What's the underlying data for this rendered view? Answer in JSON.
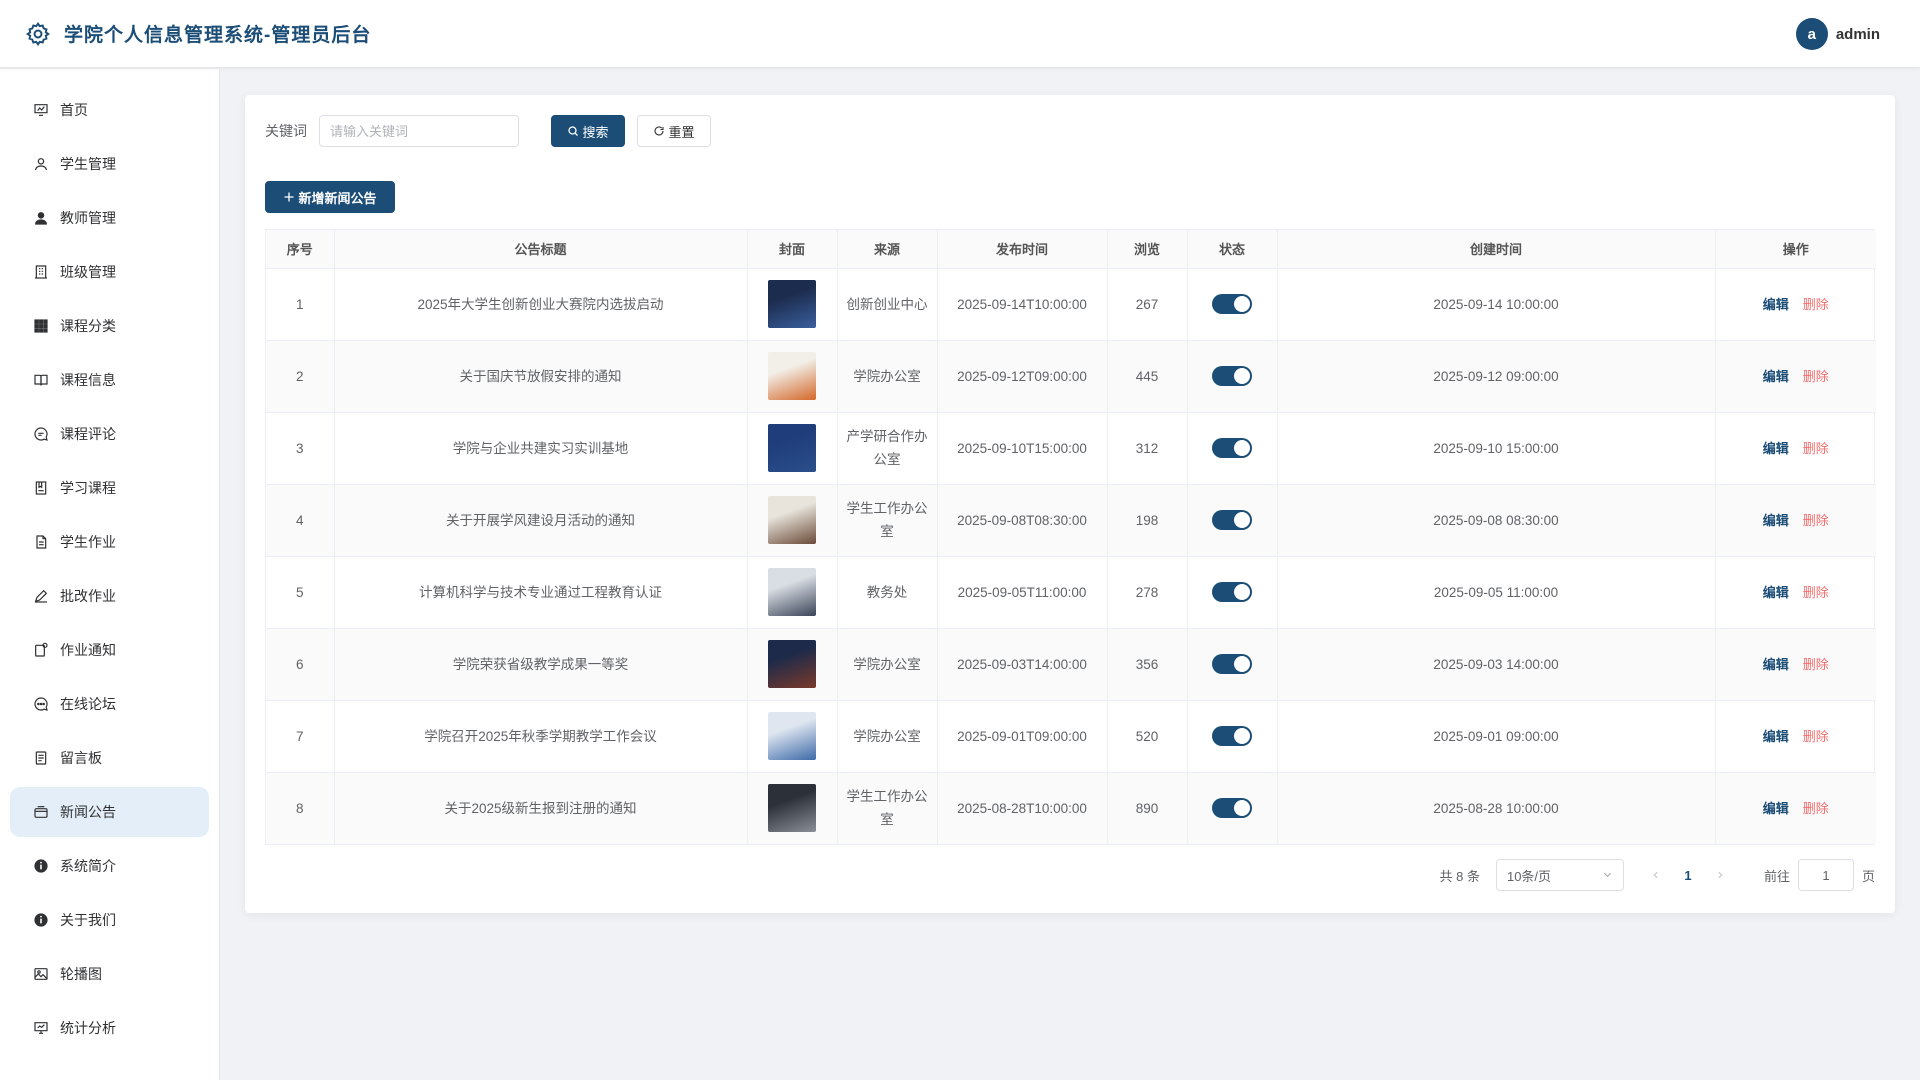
{
  "header": {
    "title": "学院个人信息管理系统-管理员后台",
    "avatar_letter": "a",
    "username": "admin"
  },
  "sidebar": {
    "items": [
      {
        "label": "首页",
        "icon": "dashboard-icon"
      },
      {
        "label": "学生管理",
        "icon": "user-outline-icon"
      },
      {
        "label": "教师管理",
        "icon": "user-filled-icon"
      },
      {
        "label": "班级管理",
        "icon": "building-icon"
      },
      {
        "label": "课程分类",
        "icon": "grid-icon"
      },
      {
        "label": "课程信息",
        "icon": "book-icon"
      },
      {
        "label": "课程评论",
        "icon": "comment-icon"
      },
      {
        "label": "学习课程",
        "icon": "notebook-icon"
      },
      {
        "label": "学生作业",
        "icon": "document-icon"
      },
      {
        "label": "批改作业",
        "icon": "pen-icon"
      },
      {
        "label": "作业通知",
        "icon": "notification-icon"
      },
      {
        "label": "在线论坛",
        "icon": "chat-icon"
      },
      {
        "label": "留言板",
        "icon": "memo-icon"
      },
      {
        "label": "新闻公告",
        "icon": "news-icon",
        "active": true
      },
      {
        "label": "系统简介",
        "icon": "info-icon"
      },
      {
        "label": "关于我们",
        "icon": "info-icon"
      },
      {
        "label": "轮播图",
        "icon": "picture-icon"
      },
      {
        "label": "统计分析",
        "icon": "chart-icon"
      }
    ]
  },
  "search": {
    "label": "关键词",
    "placeholder": "请输入关键词",
    "value": "",
    "search_label": "搜索",
    "reset_label": "重置"
  },
  "toolbar": {
    "add_label": "新增新闻公告"
  },
  "table": {
    "headers": [
      "序号",
      "公告标题",
      "封面",
      "来源",
      "发布时间",
      "浏览",
      "状态",
      "创建时间",
      "操作"
    ],
    "edit_label": "编辑",
    "delete_label": "删除",
    "rows": [
      {
        "index": "1",
        "title": "2025年大学生创新创业大赛院内选拔启动",
        "source": "创新创业中心",
        "publish_time": "2025-09-14T10:00:00",
        "views": "267",
        "enabled": true,
        "created": "2025-09-14 10:00:00",
        "cover_colors": [
          "#1c2c4e",
          "#3a5f9e"
        ]
      },
      {
        "index": "2",
        "title": "关于国庆节放假安排的通知",
        "source": "学院办公室",
        "publish_time": "2025-09-12T09:00:00",
        "views": "445",
        "enabled": true,
        "created": "2025-09-12 09:00:00",
        "cover_colors": [
          "#f2efe8",
          "#d4682a"
        ]
      },
      {
        "index": "3",
        "title": "学院与企业共建实习实训基地",
        "source": "产学研合作办公室",
        "publish_time": "2025-09-10T15:00:00",
        "views": "312",
        "enabled": true,
        "created": "2025-09-10 15:00:00",
        "cover_colors": [
          "#1f3d7a",
          "#2a4f8a"
        ]
      },
      {
        "index": "4",
        "title": "关于开展学风建设月活动的通知",
        "source": "学生工作办公室",
        "publish_time": "2025-09-08T08:30:00",
        "views": "198",
        "enabled": true,
        "created": "2025-09-08 08:30:00",
        "cover_colors": [
          "#e8e4dc",
          "#6a4a38"
        ]
      },
      {
        "index": "5",
        "title": "计算机科学与技术专业通过工程教育认证",
        "source": "教务处",
        "publish_time": "2025-09-05T11:00:00",
        "views": "278",
        "enabled": true,
        "created": "2025-09-05 11:00:00",
        "cover_colors": [
          "#d9dde4",
          "#3a4458"
        ]
      },
      {
        "index": "6",
        "title": "学院荣获省级教学成果一等奖",
        "source": "学院办公室",
        "publish_time": "2025-09-03T14:00:00",
        "views": "356",
        "enabled": true,
        "created": "2025-09-03 14:00:00",
        "cover_colors": [
          "#1e2a4a",
          "#7a3a2a"
        ]
      },
      {
        "index": "7",
        "title": "学院召开2025年秋季学期教学工作会议",
        "source": "学院办公室",
        "publish_time": "2025-09-01T09:00:00",
        "views": "520",
        "enabled": true,
        "created": "2025-09-01 09:00:00",
        "cover_colors": [
          "#dfe6f0",
          "#3d6aa8"
        ]
      },
      {
        "index": "8",
        "title": "关于2025级新生报到注册的通知",
        "source": "学生工作办公室",
        "publish_time": "2025-08-28T10:00:00",
        "views": "890",
        "enabled": true,
        "created": "2025-08-28 10:00:00",
        "cover_colors": [
          "#2c3038",
          "#8a8e96"
        ]
      }
    ]
  },
  "pagination": {
    "total_text": "共 8 条",
    "page_size": "10条/页",
    "current_page": "1",
    "goto_label": "前往",
    "goto_value": "1",
    "goto_suffix": "页"
  },
  "colors": {
    "primary": "#1b4d77",
    "danger": "#f56c6c",
    "active_menu_bg": "#e4eef8"
  }
}
